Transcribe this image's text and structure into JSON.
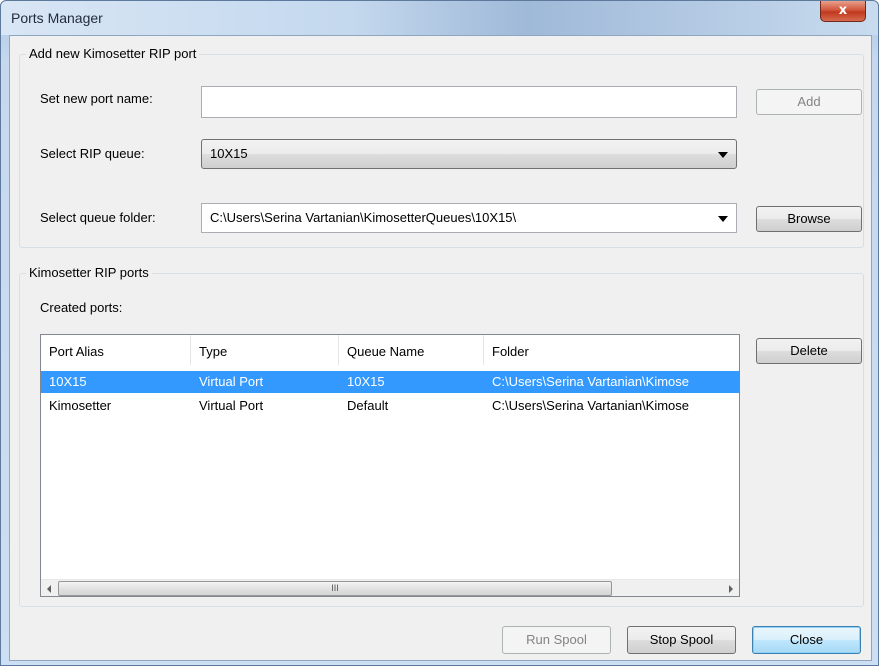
{
  "window": {
    "title": "Ports Manager",
    "close_glyph": "x"
  },
  "add_group": {
    "legend": "Add new Kimosetter RIP port",
    "port_name_label": "Set new port name:",
    "port_name_value": "",
    "add_label": "Add",
    "rip_queue_label": "Select RIP queue:",
    "rip_queue_value": "10X15",
    "queue_folder_label": "Select queue folder:",
    "queue_folder_value": "C:\\Users\\Serina Vartanian\\KimosetterQueues\\10X15\\",
    "browse_label": "Browse"
  },
  "ports_group": {
    "legend": "Kimosetter RIP ports",
    "created_label": "Created ports:",
    "delete_label": "Delete",
    "columns": [
      "Port Alias",
      "Type",
      "Queue Name",
      "Folder"
    ],
    "rows": [
      {
        "alias": "10X15",
        "type": "Virtual Port",
        "queue": "10X15",
        "folder": "C:\\Users\\Serina Vartanian\\Kimose",
        "selected": true
      },
      {
        "alias": "Kimosetter",
        "type": "Virtual Port",
        "queue": "Default",
        "folder": "C:\\Users\\Serina Vartanian\\Kimose",
        "selected": false
      }
    ],
    "scroll_grip": "III"
  },
  "footer": {
    "run_spool_label": "Run Spool",
    "stop_spool_label": "Stop Spool",
    "close_label": "Close"
  },
  "colors": {
    "selection": "#3399ff",
    "close_button": "#c0381e"
  }
}
